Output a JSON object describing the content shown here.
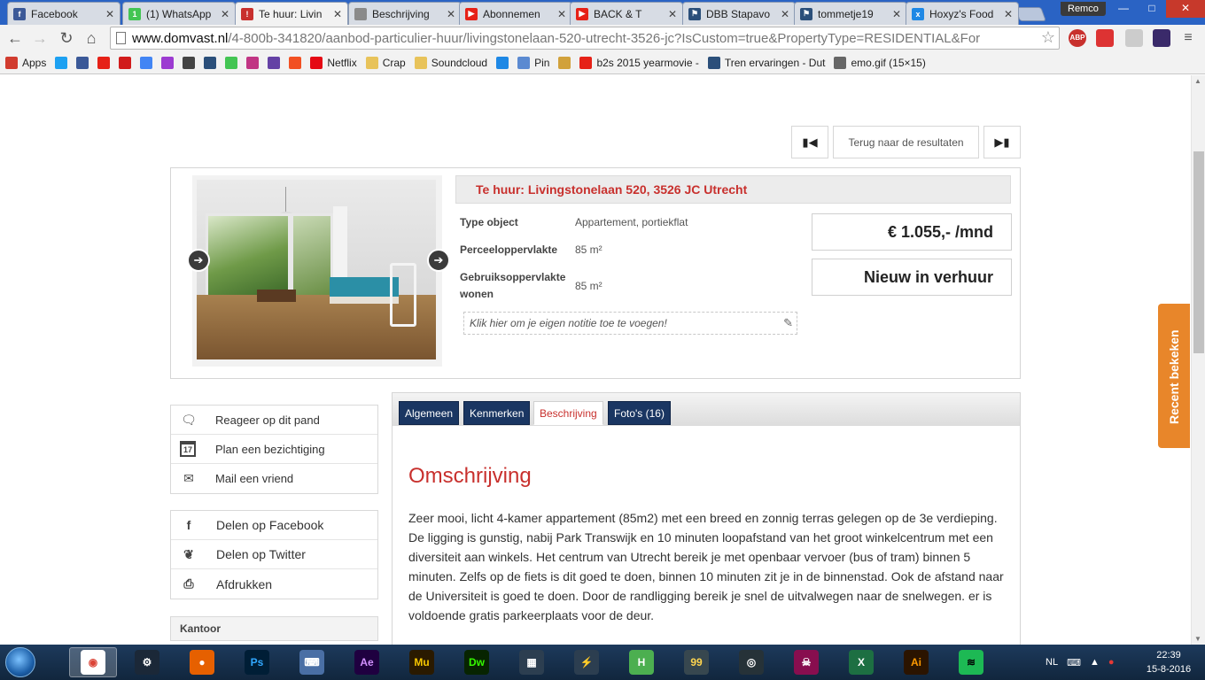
{
  "browser": {
    "tabs": [
      {
        "title": "Facebook",
        "favicon_color": "#3b5998",
        "favicon_glyph": "f"
      },
      {
        "title": "(1) WhatsApp",
        "favicon_color": "#43c553",
        "favicon_glyph": "1"
      },
      {
        "title": "Te huur: Livin",
        "favicon_color": "#c8302d",
        "favicon_glyph": "!"
      },
      {
        "title": "Beschrijving",
        "favicon_color": "#8a8a8a",
        "favicon_glyph": ""
      },
      {
        "title": "Abonnemen",
        "favicon_color": "#e62117",
        "favicon_glyph": "▶"
      },
      {
        "title": "BACK & T",
        "favicon_color": "#e62117",
        "favicon_glyph": "▶"
      },
      {
        "title": "DBB Stapavo",
        "favicon_color": "#2b4f7a",
        "favicon_glyph": "⚑"
      },
      {
        "title": "tommetje19",
        "favicon_color": "#2b4f7a",
        "favicon_glyph": "⚑"
      },
      {
        "title": "Hoxyz's Food",
        "favicon_color": "#1e88e5",
        "favicon_glyph": "x"
      }
    ],
    "profile_name": "Remco",
    "url_host": "www.domvast.nl",
    "url_path": "/4-800b-341820/aanbod-particulier-huur/livingstonelaan-520-utrecht-3526-jc?IsCustom=true&PropertyType=RESIDENTIAL&For",
    "bookmarks": [
      {
        "label": "Apps",
        "icon_color": "#d13c2f"
      },
      {
        "label": "",
        "icon_color": "#1da1f2"
      },
      {
        "label": "",
        "icon_color": "#3b5998"
      },
      {
        "label": "",
        "icon_color": "#e62117"
      },
      {
        "label": "",
        "icon_color": "#d11b1b"
      },
      {
        "label": "",
        "icon_color": "#4285f4"
      },
      {
        "label": "",
        "icon_color": "#9c3bd1"
      },
      {
        "label": "",
        "icon_color": "#444444"
      },
      {
        "label": "",
        "icon_color": "#2b4f7a"
      },
      {
        "label": "",
        "icon_color": "#43c553"
      },
      {
        "label": "",
        "icon_color": "#c13584"
      },
      {
        "label": "",
        "icon_color": "#6441a5"
      },
      {
        "label": "",
        "icon_color": "#f25022"
      },
      {
        "label": "Netflix",
        "icon_color": "#e50914"
      },
      {
        "label": "Crap",
        "icon_color": "#e8c35a"
      },
      {
        "label": "Soundcloud",
        "icon_color": "#e8c35a"
      },
      {
        "label": "",
        "icon_color": "#1e88e5"
      },
      {
        "label": "Pin",
        "icon_color": "#5b8ad1"
      },
      {
        "label": "",
        "icon_color": "#d1a13b"
      },
      {
        "label": "b2s 2015 yearmovie -",
        "icon_color": "#e62117"
      },
      {
        "label": "Tren ervaringen - Dut",
        "icon_color": "#2b4f7a"
      },
      {
        "label": "emo.gif (15×15)",
        "icon_color": "#666666"
      }
    ]
  },
  "page": {
    "pager": {
      "prev_icon": "skip-back-icon",
      "back_label": "Terug naar de resultaten",
      "next_icon": "skip-forward-icon"
    },
    "listing": {
      "title": "Te huur: Livingstonelaan 520, 3526 JC Utrecht",
      "specs": [
        {
          "key": "Type object",
          "value": "Appartement, portiekflat"
        },
        {
          "key": "Perceeloppervlakte",
          "value": "85 m²"
        },
        {
          "key": "Gebruiksoppervlakte wonen",
          "value": "85 m²"
        }
      ],
      "note_placeholder": "Klik hier om je eigen notitie toe te voegen!",
      "price": "€ 1.055,- /mnd",
      "status": "Nieuw in verhuur"
    },
    "actions": [
      {
        "label": "Reageer op dit pand",
        "icon": "chat-icon"
      },
      {
        "label": "Plan een bezichtiging",
        "icon": "calendar-icon",
        "calendar_day": "17"
      },
      {
        "label": "Mail een vriend",
        "icon": "mail-icon"
      }
    ],
    "share": [
      {
        "label": "Delen op Facebook",
        "icon": "facebook-icon"
      },
      {
        "label": "Delen op Twitter",
        "icon": "twitter-icon"
      },
      {
        "label": "Afdrukken",
        "icon": "print-icon"
      }
    ],
    "office_heading": "Kantoor",
    "tabs": [
      {
        "label": "Algemeen",
        "active": false
      },
      {
        "label": "Kenmerken",
        "active": false
      },
      {
        "label": "Beschrijving",
        "active": true
      },
      {
        "label": "Foto's (16)",
        "active": false
      }
    ],
    "description": {
      "heading": "Omschrijving",
      "paragraphs": [
        "Zeer mooi, licht 4-kamer appartement (85m2) met een breed en zonnig terras gelegen op de 3e verdieping.",
        "De ligging is gunstig, nabij Park Transwijk en 10 minuten loopafstand van het groot winkelcentrum met een diversiteit aan winkels. Het centrum van Utrecht bereik je met openbaar vervoer (bus of tram) binnen 5 minuten. Zelfs op de fiets is dit goed te doen, binnen 10 minuten zit je in de binnenstad. Ook de afstand naar de Universiteit is goed te doen. Door de randligging bereik je snel de uitvalwegen naar de snelwegen. er is voldoende gratis parkeerplaats voor de deur."
      ]
    },
    "recent_label": "Recent bekeken"
  },
  "taskbar": {
    "apps": [
      {
        "name": "chrome",
        "bg": "#ffffff",
        "fg": "#db4437",
        "glyph": "◉",
        "active": true
      },
      {
        "name": "steam",
        "bg": "#1b2838",
        "fg": "#ffffff",
        "glyph": "⚙",
        "active": false
      },
      {
        "name": "firefox",
        "bg": "#e66000",
        "fg": "#ffffff",
        "glyph": "●",
        "active": false
      },
      {
        "name": "photoshop",
        "bg": "#001e36",
        "fg": "#31a8ff",
        "glyph": "Ps",
        "active": false
      },
      {
        "name": "keyboard",
        "bg": "#4a6fa5",
        "fg": "#ffffff",
        "glyph": "⌨",
        "active": false
      },
      {
        "name": "after-effects",
        "bg": "#1f0040",
        "fg": "#d291ff",
        "glyph": "Ae",
        "active": false
      },
      {
        "name": "muse",
        "bg": "#2a1a00",
        "fg": "#f7c700",
        "glyph": "Mu",
        "active": false
      },
      {
        "name": "dreamweaver",
        "bg": "#072401",
        "fg": "#35fa00",
        "glyph": "Dw",
        "active": false
      },
      {
        "name": "video-editor",
        "bg": "#2c3e50",
        "fg": "#ffffff",
        "glyph": "▦",
        "active": false
      },
      {
        "name": "gpu-tool",
        "bg": "#2c3e50",
        "fg": "#7cd33a",
        "glyph": "⚡",
        "active": false
      },
      {
        "name": "h-app",
        "bg": "#4caf50",
        "fg": "#ffffff",
        "glyph": "H",
        "active": false
      },
      {
        "name": "99-app",
        "bg": "#37474f",
        "fg": "#ffd54f",
        "glyph": "99",
        "active": false
      },
      {
        "name": "cd-app",
        "bg": "#263238",
        "fg": "#ffffff",
        "glyph": "◎",
        "active": false
      },
      {
        "name": "game-app",
        "bg": "#880e4f",
        "fg": "#ffffff",
        "glyph": "☠",
        "active": false
      },
      {
        "name": "excel",
        "bg": "#1d6f42",
        "fg": "#ffffff",
        "glyph": "X",
        "active": false
      },
      {
        "name": "illustrator",
        "bg": "#2b1400",
        "fg": "#ff9a00",
        "glyph": "Ai",
        "active": false
      },
      {
        "name": "spotify",
        "bg": "#1db954",
        "fg": "#000000",
        "glyph": "≋",
        "active": false
      }
    ],
    "language": "NL",
    "time": "22:39",
    "date": "15-8-2016"
  }
}
